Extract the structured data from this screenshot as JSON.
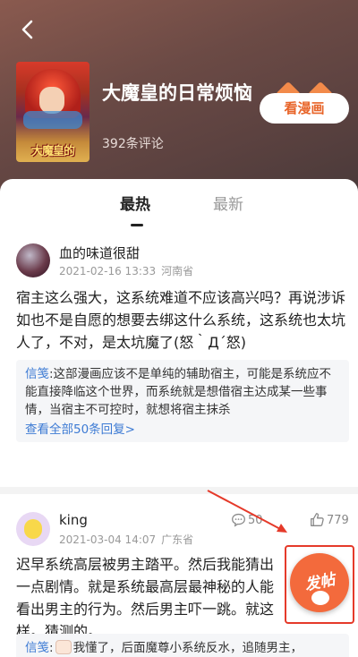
{
  "header": {
    "comic_title": "大魔皇的日常烦恼",
    "comment_count": "392条评论",
    "watch_button": "看漫画",
    "cover_title": "大魔皇的"
  },
  "tabs": [
    {
      "label": "最热",
      "active": true
    },
    {
      "label": "最新",
      "active": false
    }
  ],
  "comments": [
    {
      "username": "血的味道很甜",
      "datetime": "2021-02-16 13:33",
      "location": "河南省",
      "text": "宿主这么强大，这系统难道不应该高兴吗？再说涉诉如也不是自愿的想要去绑这什么系统，这系统也太坑人了，不对，是太坑魔了(怒｀Д´怒)",
      "reply_author": "信笺",
      "reply_text": ":这部漫画应该不是单纯的辅助宿主，可能是系统应不能直接降临这个世界，而系统就是想借宿主达成某一些事情，当宿主不可控时，就想将宿主抹杀",
      "reply_more": "查看全部50条回复>",
      "comment_count": "50",
      "like_count": "779"
    },
    {
      "username": "king",
      "datetime": "2021-03-04 14:07",
      "location": "广东省",
      "text": "迟早系统高层被男主踏平。然后我能猜出一点剧情。就是系统最高层最神秘的人能看出男主的行为。然后男主吓一跳。就这样。猜测的。",
      "reply_author": "信笺",
      "reply_text": "我懂了，后面魔尊小系统反水，追随男主，"
    }
  ],
  "fab": {
    "label": "发帖"
  },
  "colors": {
    "accent": "#f36a3c",
    "link": "#3d7bd4",
    "highlight": "#e53a2a"
  },
  "icons": [
    "back-arrow-icon",
    "comment-icon",
    "like-icon"
  ]
}
